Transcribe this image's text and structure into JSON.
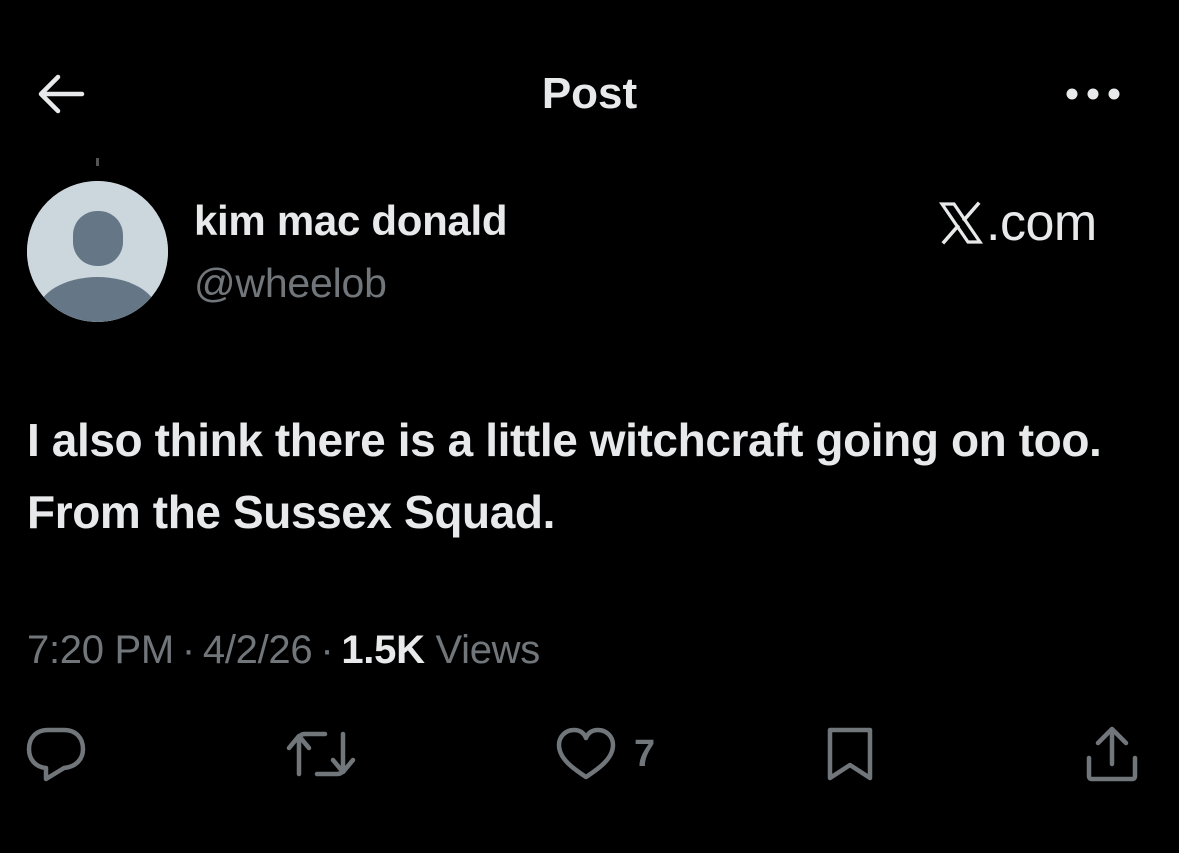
{
  "header": {
    "title": "Post",
    "back_icon": "arrow-left-icon",
    "more_icon": "ellipsis-icon"
  },
  "author": {
    "name": "kim mac donald",
    "handle": "@wheelob",
    "avatar_icon": "default-avatar-icon"
  },
  "watermark": {
    "logo_icon": "x-logo-icon",
    "text": ".com"
  },
  "tweet": {
    "text": "I also think there is a little witchcraft going on too. From the Sussex Squad."
  },
  "meta": {
    "time": "7:20 PM",
    "separator": "·",
    "date": "4/2/26",
    "views_count": "1.5K",
    "views_label": "Views"
  },
  "actions": {
    "reply_icon": "reply-icon",
    "repost_icon": "repost-icon",
    "like_icon": "heart-icon",
    "like_count": "7",
    "bookmark_icon": "bookmark-icon",
    "share_icon": "share-icon"
  },
  "colors": {
    "background": "#000000",
    "primary_text": "#e7e9ea",
    "secondary_text": "#71767b",
    "avatar_bg": "#ccd6dd",
    "avatar_fg": "#657786"
  }
}
